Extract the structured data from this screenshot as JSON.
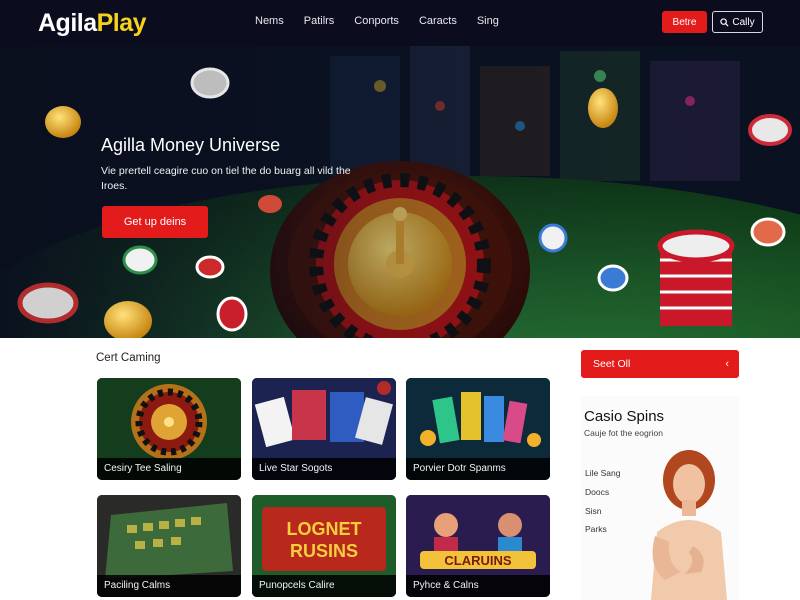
{
  "header": {
    "logo_white": "Agila",
    "logo_yellow": "Play",
    "nav": [
      "Nems",
      "Patilrs",
      "Conports",
      "Caracts",
      "Sing"
    ],
    "primary_btn": "Betre",
    "secondary_btn": "Cally"
  },
  "hero": {
    "title": "Agilla Money Universe",
    "subtitle": "Vie prertell ceagire cuo on tiel the do buarg all vild the Iroes.",
    "cta": "Get up deins"
  },
  "games": {
    "title": "Cert Caming",
    "cards": [
      {
        "label": "Cesiry Tee Saling"
      },
      {
        "label": "Live Star Sogots"
      },
      {
        "label": "Porvier Dotr Spanms"
      },
      {
        "label": "Paciling Calms"
      },
      {
        "label": "Punopcels Calire"
      },
      {
        "label": "Pyhce & Calns"
      }
    ]
  },
  "sidebar": {
    "button": "Seet Oll",
    "title": "Casio Spins",
    "subtitle": "Cauje fot the eogrion",
    "links": [
      "Lile Sang",
      "Doocs",
      "Sisn",
      "Parks"
    ]
  },
  "colors": {
    "accent": "#e31b1b",
    "brand_yellow": "#f6d21c",
    "header_bg": "#0b0d1e"
  }
}
